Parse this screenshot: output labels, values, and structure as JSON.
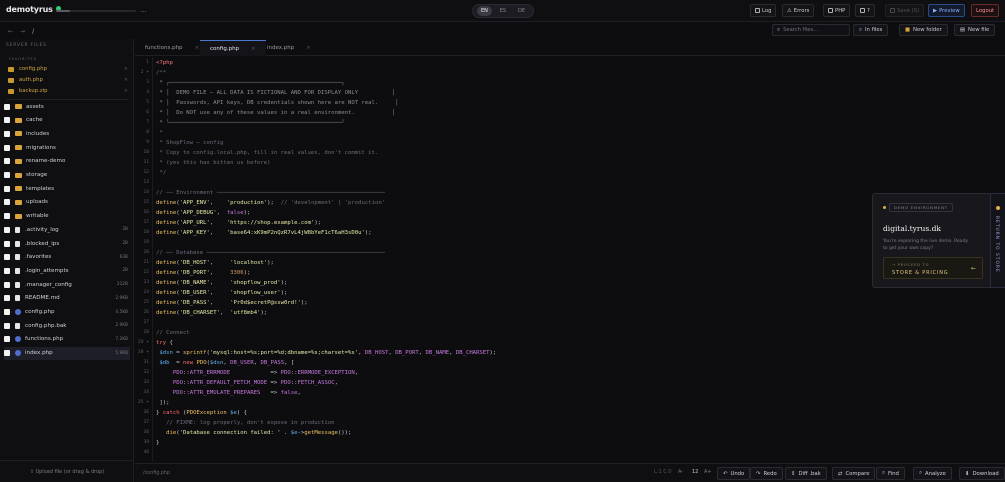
{
  "app": {
    "brand": "demotyrus",
    "menu_glyph": "..."
  },
  "lang": {
    "options": [
      "EN",
      "ES",
      "DE"
    ],
    "active": "EN"
  },
  "toolbar": {
    "log": "Log",
    "errors": "Errors",
    "php": "PHP",
    "help": "?",
    "save": "Save (S)",
    "preview": "Preview",
    "logout": "Logout"
  },
  "path": {
    "back": "←",
    "forward": "→",
    "root": "/"
  },
  "sidebar": {
    "title": "SERVER FILES",
    "favorites_title": "FAVORITES",
    "favorites": [
      {
        "label": "config.php"
      },
      {
        "label": "auth.php"
      },
      {
        "label": "backup.zip"
      }
    ],
    "items": [
      {
        "label": "assets",
        "type": "folder",
        "size": ""
      },
      {
        "label": "cache",
        "type": "folder",
        "size": ""
      },
      {
        "label": "includes",
        "type": "folder",
        "size": ""
      },
      {
        "label": "migrations",
        "type": "folder",
        "size": ""
      },
      {
        "label": "rename-demo",
        "type": "folder",
        "size": ""
      },
      {
        "label": "storage",
        "type": "folder",
        "size": ""
      },
      {
        "label": "templates",
        "type": "folder",
        "size": ""
      },
      {
        "label": "uploads",
        "type": "folder",
        "size": ""
      },
      {
        "label": "writable",
        "type": "folder",
        "size": ""
      },
      {
        "label": ".activity_log",
        "type": "file",
        "size": "2B"
      },
      {
        "label": ".blocked_ips",
        "type": "file",
        "size": "2B"
      },
      {
        "label": ".favorites",
        "type": "file",
        "size": "63B"
      },
      {
        "label": ".login_attempts",
        "type": "file",
        "size": "2B"
      },
      {
        "label": ".manager_config",
        "type": "file",
        "size": "212B"
      },
      {
        "label": "README.md",
        "type": "file",
        "size": "2.9KB"
      },
      {
        "label": "config.php",
        "type": "php",
        "size": "4.5KB"
      },
      {
        "label": "config.php.bak",
        "type": "file",
        "size": "2.9KB"
      },
      {
        "label": "functions.php",
        "type": "php",
        "size": "7.2KB"
      },
      {
        "label": "index.php",
        "type": "php",
        "size": "5.9KB"
      }
    ],
    "upload": "⇧ Upload file (or drag & drop)"
  },
  "tabs": [
    {
      "label": "functions.php",
      "close": "×"
    },
    {
      "label": "config.php",
      "close": "×"
    },
    {
      "label": "index.php",
      "close": "×"
    }
  ],
  "file_tools": {
    "search_placeholder": "Search files...",
    "in_files": "In files",
    "new_folder": "New folder",
    "new_file": "New file"
  },
  "code": [
    [
      [
        "tag",
        "<?php"
      ]
    ],
    [
      [
        "cm",
        "/**"
      ]
    ],
    [
      [
        "box",
        " * ┌───────────────────────────────────────────────────┐"
      ]
    ],
    [
      [
        "box",
        " * │  DEMO FILE — ALL DATA IS FICTIONAL AND FOR DISPLAY ONLY          │"
      ]
    ],
    [
      [
        "box",
        " * │  Passwords, API keys, DB credentials shown here are NOT real.     │"
      ]
    ],
    [
      [
        "box",
        " * │  Do NOT use any of these values in a real environment.           │"
      ]
    ],
    [
      [
        "box",
        " * └───────────────────────────────────────────────────┘"
      ]
    ],
    [
      [
        "cm",
        " *"
      ]
    ],
    [
      [
        "cm",
        " * ShopFlow — config"
      ]
    ],
    [
      [
        "cm",
        " * Copy to config.local.php, fill in real values, don't commit it."
      ]
    ],
    [
      [
        "cm",
        " * (yes this has bitten us before)"
      ]
    ],
    [
      [
        "cm",
        " */"
      ]
    ],
    [],
    [
      [
        "cm",
        "// ── Environment ──────────────────────────────────────────────────"
      ]
    ],
    [
      [
        "fn",
        "define"
      ],
      [
        "",
        "("
      ],
      [
        "str",
        "'APP_ENV'"
      ],
      [
        "",
        ",    "
      ],
      [
        "str",
        "'production'"
      ],
      [
        "",
        ");  "
      ],
      [
        "cm",
        "// 'development' | 'production'"
      ]
    ],
    [
      [
        "fn",
        "define"
      ],
      [
        "",
        "("
      ],
      [
        "str",
        "'APP_DEBUG'"
      ],
      [
        "",
        ",  "
      ],
      [
        "con",
        "false"
      ],
      [
        "",
        ");"
      ]
    ],
    [
      [
        "fn",
        "define"
      ],
      [
        "",
        "("
      ],
      [
        "str",
        "'APP_URL'"
      ],
      [
        "",
        ",    "
      ],
      [
        "str",
        "'https://shop.example.com'"
      ],
      [
        "",
        ");"
      ]
    ],
    [
      [
        "fn",
        "define"
      ],
      [
        "",
        "("
      ],
      [
        "str",
        "'APP_KEY'"
      ],
      [
        "",
        ",    "
      ],
      [
        "str",
        "'base64:xK9mP2nQzR7vL4jW8bYeF1cT6aH3sD0u'"
      ],
      [
        "",
        ");"
      ]
    ],
    [],
    [
      [
        "cm",
        "// ── Database ─────────────────────────────────────────────────────"
      ]
    ],
    [
      [
        "fn",
        "define"
      ],
      [
        "",
        "("
      ],
      [
        "str",
        "'DB_HOST'"
      ],
      [
        "",
        ",     "
      ],
      [
        "str",
        "'localhost'"
      ],
      [
        "",
        ");"
      ]
    ],
    [
      [
        "fn",
        "define"
      ],
      [
        "",
        "("
      ],
      [
        "str",
        "'DB_PORT'"
      ],
      [
        "",
        ",     "
      ],
      [
        "num",
        "3306"
      ],
      [
        "",
        ");"
      ]
    ],
    [
      [
        "fn",
        "define"
      ],
      [
        "",
        "("
      ],
      [
        "str",
        "'DB_NAME'"
      ],
      [
        "",
        ",     "
      ],
      [
        "str",
        "'shopflow_prod'"
      ],
      [
        "",
        ");"
      ]
    ],
    [
      [
        "fn",
        "define"
      ],
      [
        "",
        "("
      ],
      [
        "str",
        "'DB_USER'"
      ],
      [
        "",
        ",     "
      ],
      [
        "str",
        "'shopflow_user'"
      ],
      [
        "",
        ");"
      ]
    ],
    [
      [
        "fn",
        "define"
      ],
      [
        "",
        "("
      ],
      [
        "str",
        "'DB_PASS'"
      ],
      [
        "",
        ",     "
      ],
      [
        "str",
        "'Pr0d$ecretP@ssw0rd!'"
      ],
      [
        "",
        ");"
      ]
    ],
    [
      [
        "fn",
        "define"
      ],
      [
        "",
        "("
      ],
      [
        "str",
        "'DB_CHARSET'"
      ],
      [
        "",
        ",  "
      ],
      [
        "str",
        "'utf8mb4'"
      ],
      [
        "",
        ");"
      ]
    ],
    [],
    [
      [
        "cm",
        "// Connect"
      ]
    ],
    [
      [
        "kw",
        "try"
      ],
      [
        "",
        " {"
      ]
    ],
    [
      [
        "",
        " "
      ],
      [
        "var",
        "$dsn"
      ],
      [
        "",
        " = "
      ],
      [
        "fn",
        "sprintf"
      ],
      [
        "",
        "("
      ],
      [
        "str",
        "'mysql:host=%s;port=%d;dbname=%s;charset=%s'"
      ],
      [
        "",
        ", "
      ],
      [
        "con",
        "DB_HOST"
      ],
      [
        "",
        ", "
      ],
      [
        "con",
        "DB_PORT"
      ],
      [
        "",
        ", "
      ],
      [
        "con",
        "DB_NAME"
      ],
      [
        "",
        ", "
      ],
      [
        "con",
        "DB_CHARSET"
      ],
      [
        "",
        ");"
      ]
    ],
    [
      [
        "",
        " "
      ],
      [
        "var",
        "$db"
      ],
      [
        "",
        "  = "
      ],
      [
        "kw",
        "new"
      ],
      [
        "",
        " "
      ],
      [
        "fn",
        "PDO"
      ],
      [
        "",
        "("
      ],
      [
        "var",
        "$dsn"
      ],
      [
        "",
        ", "
      ],
      [
        "con",
        "DB_USER"
      ],
      [
        "",
        ", "
      ],
      [
        "con",
        "DB_PASS"
      ],
      [
        "",
        ", ["
      ]
    ],
    [
      [
        "",
        "     "
      ],
      [
        "con",
        "PDO"
      ],
      [
        "",
        "::"
      ],
      [
        "con",
        "ATTR_ERRMODE"
      ],
      [
        "",
        "            => "
      ],
      [
        "con",
        "PDO"
      ],
      [
        "",
        "::"
      ],
      [
        "con",
        "ERRMODE_EXCEPTION"
      ],
      [
        "",
        ","
      ]
    ],
    [
      [
        "",
        "     "
      ],
      [
        "con",
        "PDO"
      ],
      [
        "",
        "::"
      ],
      [
        "con",
        "ATTR_DEFAULT_FETCH_MODE"
      ],
      [
        "",
        " => "
      ],
      [
        "con",
        "PDO"
      ],
      [
        "",
        "::"
      ],
      [
        "con",
        "FETCH_ASSOC"
      ],
      [
        "",
        ","
      ]
    ],
    [
      [
        "",
        "     "
      ],
      [
        "con",
        "PDO"
      ],
      [
        "",
        "::"
      ],
      [
        "con",
        "ATTR_EMULATE_PREPARES"
      ],
      [
        "",
        "   => "
      ],
      [
        "con",
        "false"
      ],
      [
        "",
        ","
      ]
    ],
    [
      [
        "",
        " ]);"
      ]
    ],
    [
      [
        "",
        "} "
      ],
      [
        "kw",
        "catch"
      ],
      [
        "",
        " ("
      ],
      [
        "fn",
        "PDOException"
      ],
      [
        "",
        " "
      ],
      [
        "var",
        "$e"
      ],
      [
        "",
        ") {"
      ]
    ],
    [
      [
        "",
        "   "
      ],
      [
        "cm",
        "// FIXME: log properly, don't expose in production"
      ]
    ],
    [
      [
        "",
        "   "
      ],
      [
        "fn",
        "die"
      ],
      [
        "",
        "("
      ],
      [
        "str",
        "'Database connection failed: '"
      ],
      [
        "",
        " . "
      ],
      [
        "var",
        "$e"
      ],
      [
        "",
        "->"
      ],
      [
        "fn",
        "getMessage"
      ],
      [
        "",
        "());"
      ]
    ],
    [
      [
        "",
        "}"
      ]
    ],
    []
  ],
  "status": {
    "path": "/config.php",
    "position": "L:1 C:0",
    "zoom_out": "A-",
    "font_size": "12",
    "zoom_in": "A+",
    "undo": "Undo",
    "redo": "Redo",
    "diff": "Diff .bak",
    "compare": "Compare",
    "find": "Find",
    "analyze": "Analyze",
    "download": "Download"
  },
  "promo": {
    "badge": "DEMO ENVIRONMENT",
    "title": "digital.tyrus.dk",
    "subtitle": "You're exploring the live demo. Ready to get your own copy?",
    "cta_small": "→ PROCEED TO",
    "cta": "STORE & PRICING",
    "cta_arrow": "←",
    "side_tab": "RETURN TO STORE"
  },
  "colors": {
    "accent": "#4a78d0",
    "keyword": "#ff6b6b",
    "string": "#e8e8a8",
    "function": "#f0c060",
    "folder": "#d9a43a"
  }
}
